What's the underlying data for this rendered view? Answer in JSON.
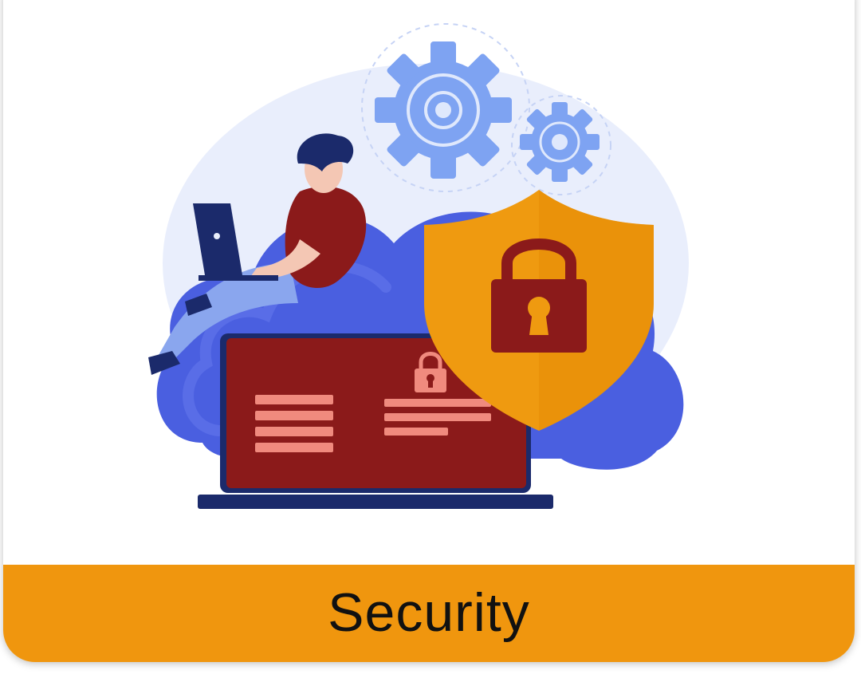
{
  "card": {
    "label": "Security"
  },
  "colors": {
    "accent": "#f0960e",
    "shield": "#ef9a10",
    "laptop": "#8b1a1a",
    "cloud": "#4a5fe0",
    "gear": "#7ea3f2",
    "background_circle": "#e9eefc"
  },
  "icons": [
    "gear-icon",
    "shield-icon",
    "padlock-icon",
    "laptop-icon",
    "cloud-icon"
  ]
}
